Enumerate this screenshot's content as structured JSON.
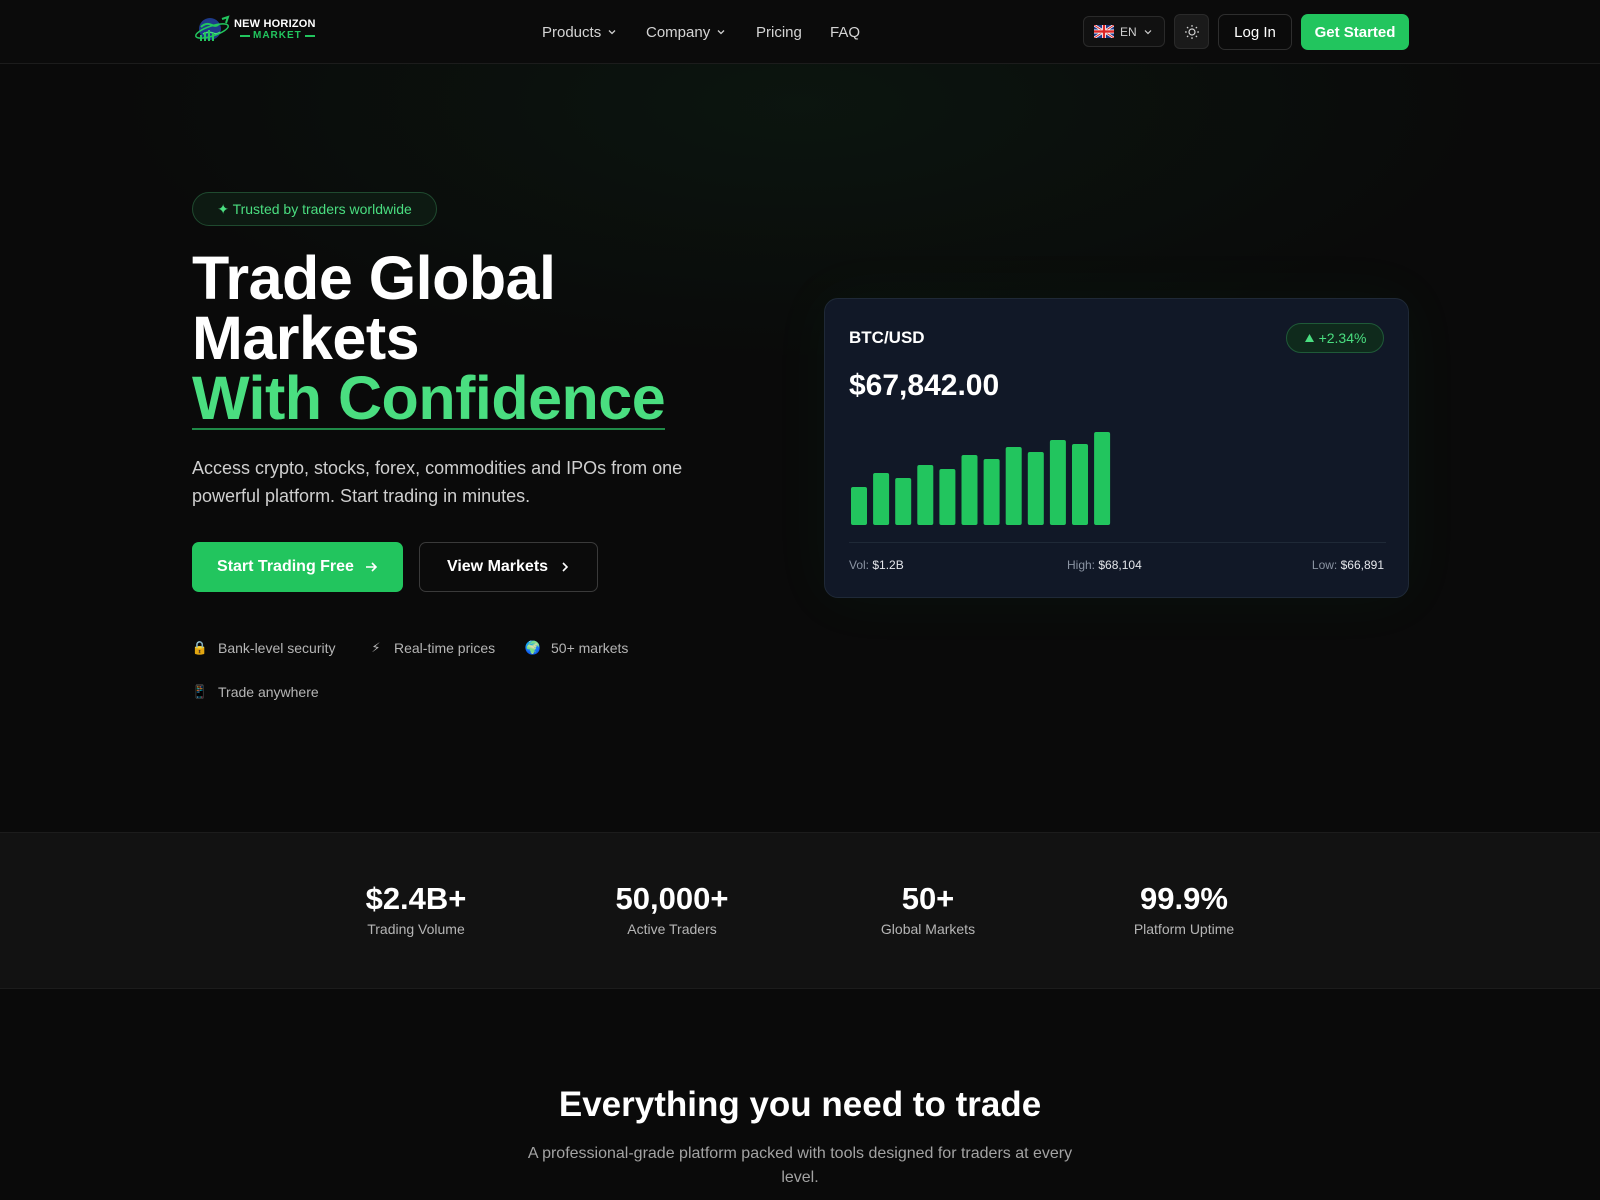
{
  "brand": {
    "name_line1": "NEW HORIZON",
    "name_line2": "MARKET",
    "accent_color": "#22c55e"
  },
  "nav": {
    "links": [
      {
        "label": "Products",
        "has_dropdown": true
      },
      {
        "label": "Company",
        "has_dropdown": true
      },
      {
        "label": "Pricing",
        "has_dropdown": false
      },
      {
        "label": "FAQ",
        "has_dropdown": false
      }
    ],
    "language": "EN",
    "language_flag_icon": "uk-flag-icon",
    "theme_icon": "sun-icon",
    "login_label": "Log In",
    "get_started_label": "Get Started"
  },
  "hero": {
    "badge": "✦ Trusted by traders worldwide",
    "title_line1": "Trade Global",
    "title_line2": "Markets",
    "title_accent": "With Confidence",
    "subtitle": "Access crypto, stocks, forex, commodities and IPOs from one powerful platform. Start trading in minutes.",
    "cta_primary": "Start Trading Free",
    "cta_secondary": "View Markets",
    "features": [
      {
        "icon": "lock-icon",
        "glyph": "🔒",
        "label": "Bank-level security"
      },
      {
        "icon": "lightning-icon",
        "glyph": "⚡",
        "label": "Real-time prices"
      },
      {
        "icon": "globe-icon",
        "glyph": "🌍",
        "label": "50+ markets"
      },
      {
        "icon": "phone-icon",
        "glyph": "📱",
        "label": "Trade anywhere"
      }
    ]
  },
  "price_card": {
    "pair": "BTC/USD",
    "change": "+2.34%",
    "price": "$67,842.00",
    "vol_label": "Vol:",
    "vol_value": "$1.2B",
    "high_label": "High:",
    "high_value": "$68,104",
    "low_label": "Low:",
    "low_value": "$66,891",
    "bar_color": "#22c55e"
  },
  "chart_data": {
    "type": "bar",
    "title": "",
    "series": [
      {
        "values": [
          38,
          52,
          47,
          60,
          56,
          70,
          66,
          78,
          73,
          85,
          81,
          93
        ]
      }
    ],
    "ylim": [
      0,
      100
    ],
    "grid": false
  },
  "stats": [
    {
      "value": "$2.4B+",
      "label": "Trading Volume"
    },
    {
      "value": "50,000+",
      "label": "Active Traders"
    },
    {
      "value": "50+",
      "label": "Global Markets"
    },
    {
      "value": "99.9%",
      "label": "Platform Uptime"
    }
  ],
  "features_section": {
    "title": "Everything you need to trade",
    "subtitle": "A professional-grade platform packed with tools designed for traders at every level."
  }
}
